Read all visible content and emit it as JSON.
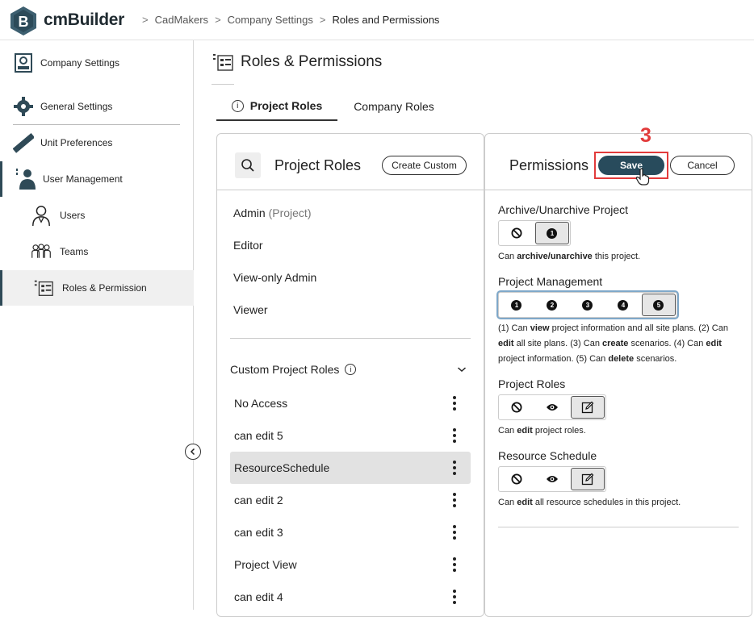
{
  "app": {
    "name": "cmBuilder",
    "logo_letter": "B"
  },
  "breadcrumb": {
    "items": [
      "CadMakers",
      "Company Settings",
      "Roles and Permissions"
    ],
    "separator": ">"
  },
  "sidebar": {
    "items": [
      {
        "label": "Company Settings",
        "icon": "company-settings-icon"
      },
      {
        "label": "General Settings",
        "icon": "gear-icon"
      },
      {
        "label": "Unit Preferences",
        "icon": "ruler-icon"
      },
      {
        "label": "User Management",
        "icon": "user-management-icon"
      },
      {
        "label": "Users",
        "icon": "user-icon"
      },
      {
        "label": "Teams",
        "icon": "team-icon"
      },
      {
        "label": "Roles & Permission",
        "icon": "roles-icon"
      }
    ],
    "collapse_icon": "chevron-left-icon"
  },
  "page": {
    "title": "Roles & Permissions"
  },
  "tabs": [
    {
      "label": "Project Roles",
      "active": true
    },
    {
      "label": "Company Roles",
      "active": false
    }
  ],
  "roles_panel": {
    "title": "Project Roles",
    "create_label": "Create Custom",
    "default_roles": [
      {
        "name": "Admin",
        "suffix": "(Project)"
      },
      {
        "name": "Editor",
        "suffix": ""
      },
      {
        "name": "View-only Admin",
        "suffix": ""
      },
      {
        "name": "Viewer",
        "suffix": ""
      }
    ],
    "custom_heading": "Custom Project Roles",
    "custom_roles": [
      "No Access",
      "can edit 5",
      "ResourceSchedule",
      "can edit 2",
      "can edit 3",
      "Project View",
      "can edit 4"
    ],
    "selected_custom_role": "ResourceSchedule"
  },
  "perm_panel": {
    "title": "Permissions",
    "save_label": "Save",
    "cancel_label": "Cancel",
    "step_number": "3",
    "groups": [
      {
        "title": "Archive/Unarchive Project",
        "desc": "Can <b>archive/unarchive</b> this project."
      },
      {
        "title": "Project Management",
        "desc": "(1) Can <b>view</b> project information and all site plans. (2) Can <b>edit</b> all site plans. (3) Can <b>create</b> scenarios. (4) Can <b>edit</b> project information. (5) Can <b>delete</b> scenarios."
      },
      {
        "title": "Project Roles",
        "desc": "Can <b>edit</b> project roles."
      },
      {
        "title": "Resource Schedule",
        "desc": "Can <b>edit</b> all resource schedules in this project."
      }
    ],
    "level_labels": {
      "numbers": [
        "1",
        "2",
        "3",
        "4",
        "5"
      ]
    }
  },
  "colors": {
    "accent": "#284b5c",
    "highlight": "#e23b3b"
  }
}
